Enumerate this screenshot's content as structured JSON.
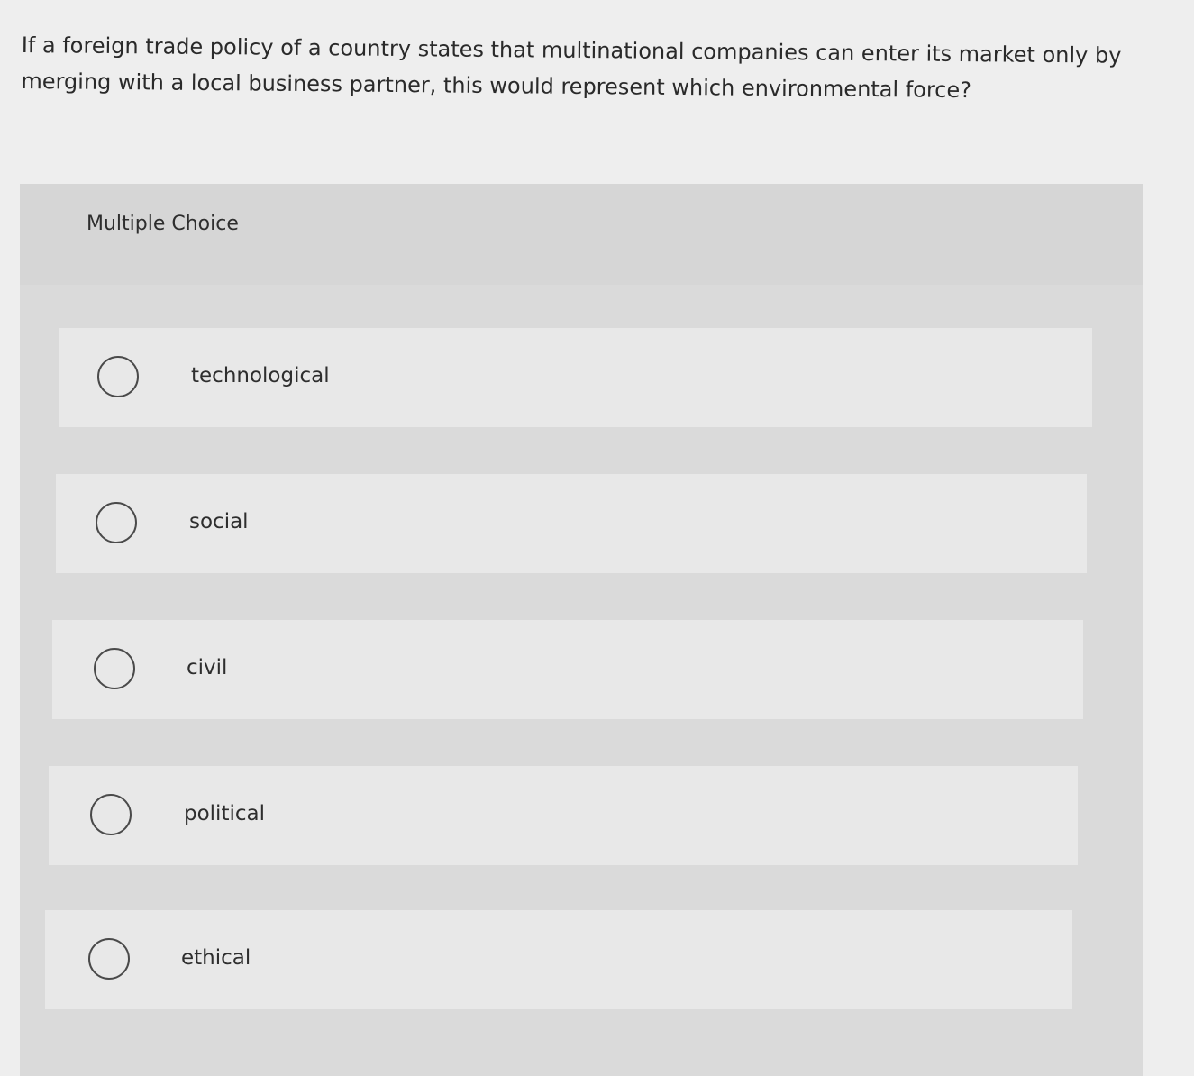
{
  "question": {
    "text": "If a foreign trade policy of a country states that multinational companies can enter its market only by merging with a local business partner, this would represent which environmental force?"
  },
  "multiple_choice": {
    "title": "Multiple Choice",
    "options": [
      {
        "label": "technological",
        "selected": false
      },
      {
        "label": "social",
        "selected": false
      },
      {
        "label": "civil",
        "selected": false
      },
      {
        "label": "political",
        "selected": false
      },
      {
        "label": "ethical",
        "selected": false
      }
    ]
  }
}
